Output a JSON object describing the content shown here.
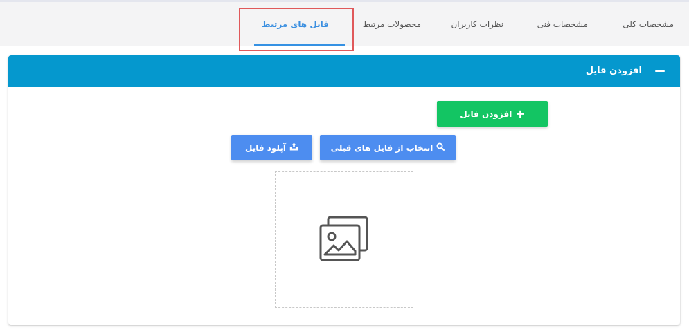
{
  "tabs": [
    {
      "label": "مشخصات کلی",
      "active": false
    },
    {
      "label": "مشخصات فنی",
      "active": false
    },
    {
      "label": "نظرات کاربران",
      "active": false
    },
    {
      "label": "محصولات مرتبط",
      "active": false
    },
    {
      "label": "فایل های مرتبط",
      "active": true
    }
  ],
  "panel": {
    "title": "افزودن فایل",
    "collapse_icon": "minus-icon",
    "header_color": "#0598ce"
  },
  "buttons": {
    "add_file": {
      "label": "افزودن فایل",
      "icon": "plus-icon",
      "color": "#13c563"
    },
    "choose_previous": {
      "label": "انتخاب از فایل های قبلی",
      "icon": "search-icon",
      "color": "#4d8df0"
    },
    "upload": {
      "label": "آپلود فایل",
      "icon": "upload-icon",
      "color": "#4d8df0"
    }
  },
  "dropzone": {
    "icon": "images-icon"
  },
  "colors": {
    "active_tab": "#3b8fe0",
    "tab_underline": "#3591e3",
    "highlight_border": "#e0595b"
  }
}
